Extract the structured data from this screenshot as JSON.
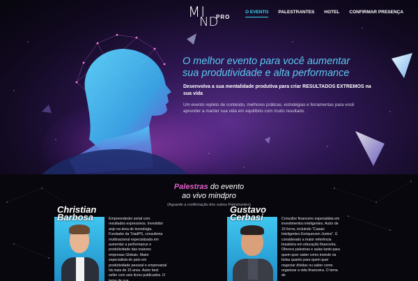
{
  "logo": {
    "m": "MI",
    "nd": "ND",
    "pro": "PRO"
  },
  "nav": [
    {
      "label": "O EVENTO",
      "active": true
    },
    {
      "label": "PALESTRANTES",
      "active": false
    },
    {
      "label": "HOTEL",
      "active": false
    },
    {
      "label": "CONFIRMAR PRESENÇA",
      "active": false
    }
  ],
  "hero": {
    "title_line1": "O melhor evento para você aumentar",
    "title_line2": "sua produtividade e alta performance",
    "subtitle": "Desenvolva a sua mentalidade produtiva para criar RESULTADOS EXTREMOS na sua vida",
    "description": "Um evento repleto de conteúdo, melhores práticas, estratégias e ferramentas para você aprender a manter sua vida em equilíbrio com muito resultado."
  },
  "speakers_section": {
    "accent": "Palestras",
    "line1_rest": " do evento",
    "line2": "ao vivo mindpro",
    "note": "(Aguarde a confirmação dos outros Palestrantes)"
  },
  "speakers": [
    {
      "first_name": "Christian",
      "last_name": "Barbosa",
      "bio": "Empreendedor serial com resultados expressivos. Investidor anjo na área de tecnologia. Fundador da TriadPS, consultoria multinacional especializada em aumentar a performance e produtividade das maiores empresas Globais. Maior especialista do país em produtividade pessoal e empresarial há mais de 15 anos. Autor best seller com seis livros publicados. O tema de sua"
    },
    {
      "first_name": "Gustavo",
      "last_name": "Cerbasi",
      "bio": "Consultor financeiro especialista em investimentos inteligentes. Autor de 15 livros, incluindo \"Casais Inteligentes Enriquecem Juntos\". É considerado a maior referência brasileira em educação financeira. Oferece palestras e aulas tanto para quem quer saber como investir na bolsa quanto para quem quer negociar dívidas ou saber como organizar a vida financeira. O tema de"
    }
  ],
  "colors": {
    "accent_cyan": "#38d8f0",
    "accent_pink": "#e060c8",
    "title_blue": "#5cc9f3"
  }
}
